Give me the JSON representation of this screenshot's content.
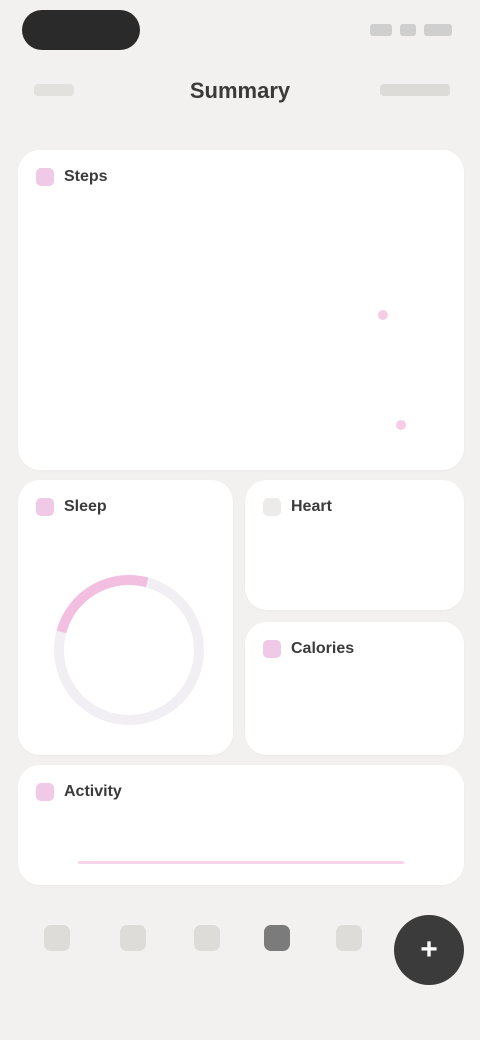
{
  "status": {
    "time": ""
  },
  "nav": {
    "title": "Summary",
    "back_label": "",
    "action_label": ""
  },
  "hero_card": {
    "title": "Steps",
    "link": "",
    "value": "",
    "sublabel": ""
  },
  "sleep_card": {
    "title": "Sleep",
    "ring_value": ""
  },
  "hr_card": {
    "title": "Heart",
    "value": ""
  },
  "calories_card": {
    "title": "Calories",
    "value": ""
  },
  "activity_card": {
    "title": "Activity",
    "link": "",
    "value": ""
  },
  "tabbar": {
    "tabs": [
      {
        "label": ""
      },
      {
        "label": ""
      },
      {
        "label": ""
      },
      {
        "label": ""
      },
      {
        "label": ""
      }
    ],
    "fab_symbol": "+"
  },
  "colors": {
    "accent": "#f3bfe1",
    "background": "#f2f1ef",
    "fab": "#3b3b3b"
  }
}
